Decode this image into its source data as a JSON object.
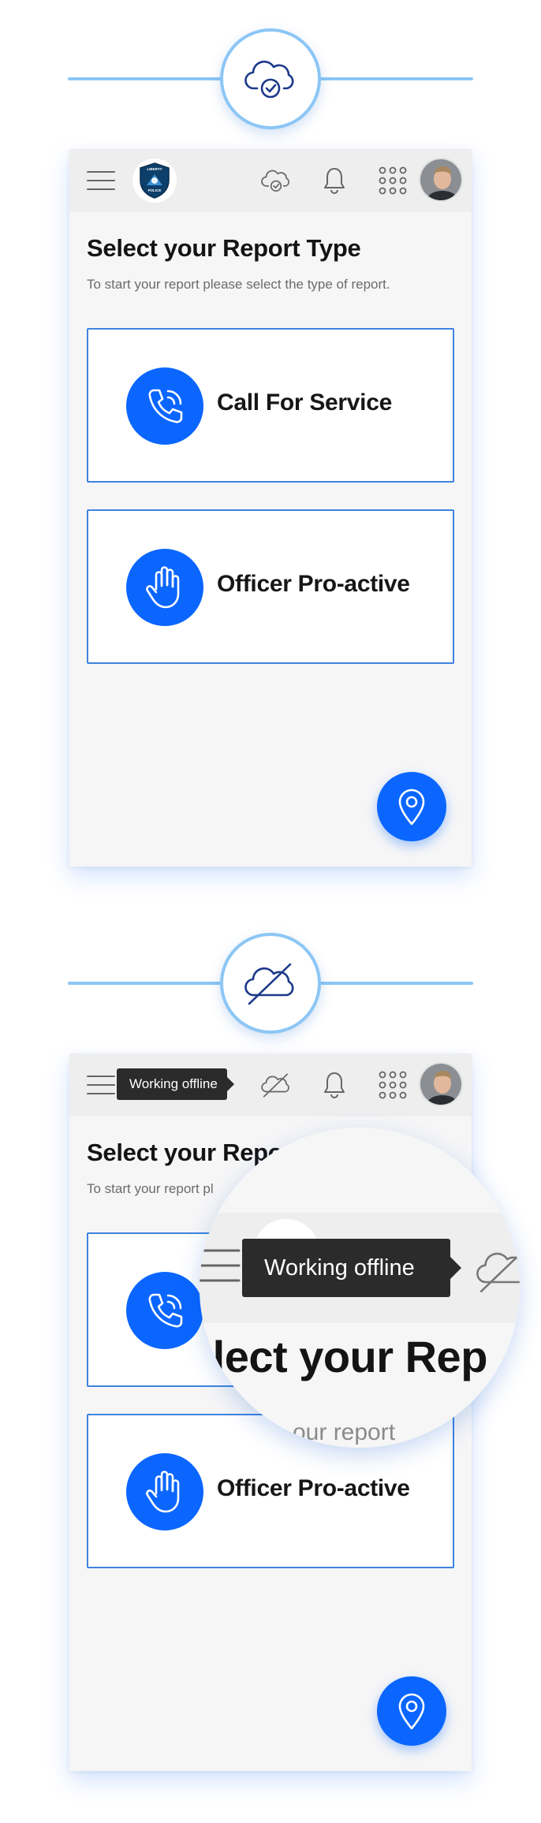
{
  "states": [
    {
      "status_icon": "cloud-check-icon",
      "header": {
        "menu_icon": "hamburger-icon",
        "logo_icon": "liberty-police-badge-icon",
        "logo_text_top": "LIBERTY",
        "logo_text_bottom": "POLICE",
        "sync_icon": "cloud-check-icon",
        "notification_icon": "bell-icon",
        "apps_icon": "app-grid-icon",
        "avatar_icon": "user-avatar"
      },
      "title": "Select your Report Type",
      "subtitle": "To start your report please select the type of report.",
      "report_types": [
        {
          "label": "Call For Service",
          "icon": "phone-call-icon"
        },
        {
          "label": "Officer Pro-active",
          "icon": "raised-hand-icon"
        }
      ],
      "fab_icon": "location-pin-icon"
    },
    {
      "status_icon": "cloud-off-icon",
      "header": {
        "menu_icon": "hamburger-icon",
        "sync_icon": "cloud-off-icon",
        "notification_icon": "bell-icon",
        "apps_icon": "app-grid-icon",
        "avatar_icon": "user-avatar"
      },
      "tooltip": "Working offline",
      "title": "Select your Repo",
      "subtitle": "To start your report pl",
      "report_types": [
        {
          "label": "",
          "icon": "phone-call-icon"
        },
        {
          "label": "Officer Pro-active",
          "icon": "raised-hand-icon"
        }
      ],
      "magnifier": {
        "tooltip": "Working offline",
        "title_fragment": "elect your Rep",
        "subtitle_fragment": "our report"
      },
      "fab_icon": "location-pin-icon"
    }
  ],
  "colors": {
    "accent": "#0a66ff",
    "divider": "#8cc6f5",
    "card_border": "#3f83df",
    "tooltip_bg": "#2b2b2b",
    "topbar_bg": "#eeeeef",
    "screen_bg": "#f6f6f7"
  }
}
